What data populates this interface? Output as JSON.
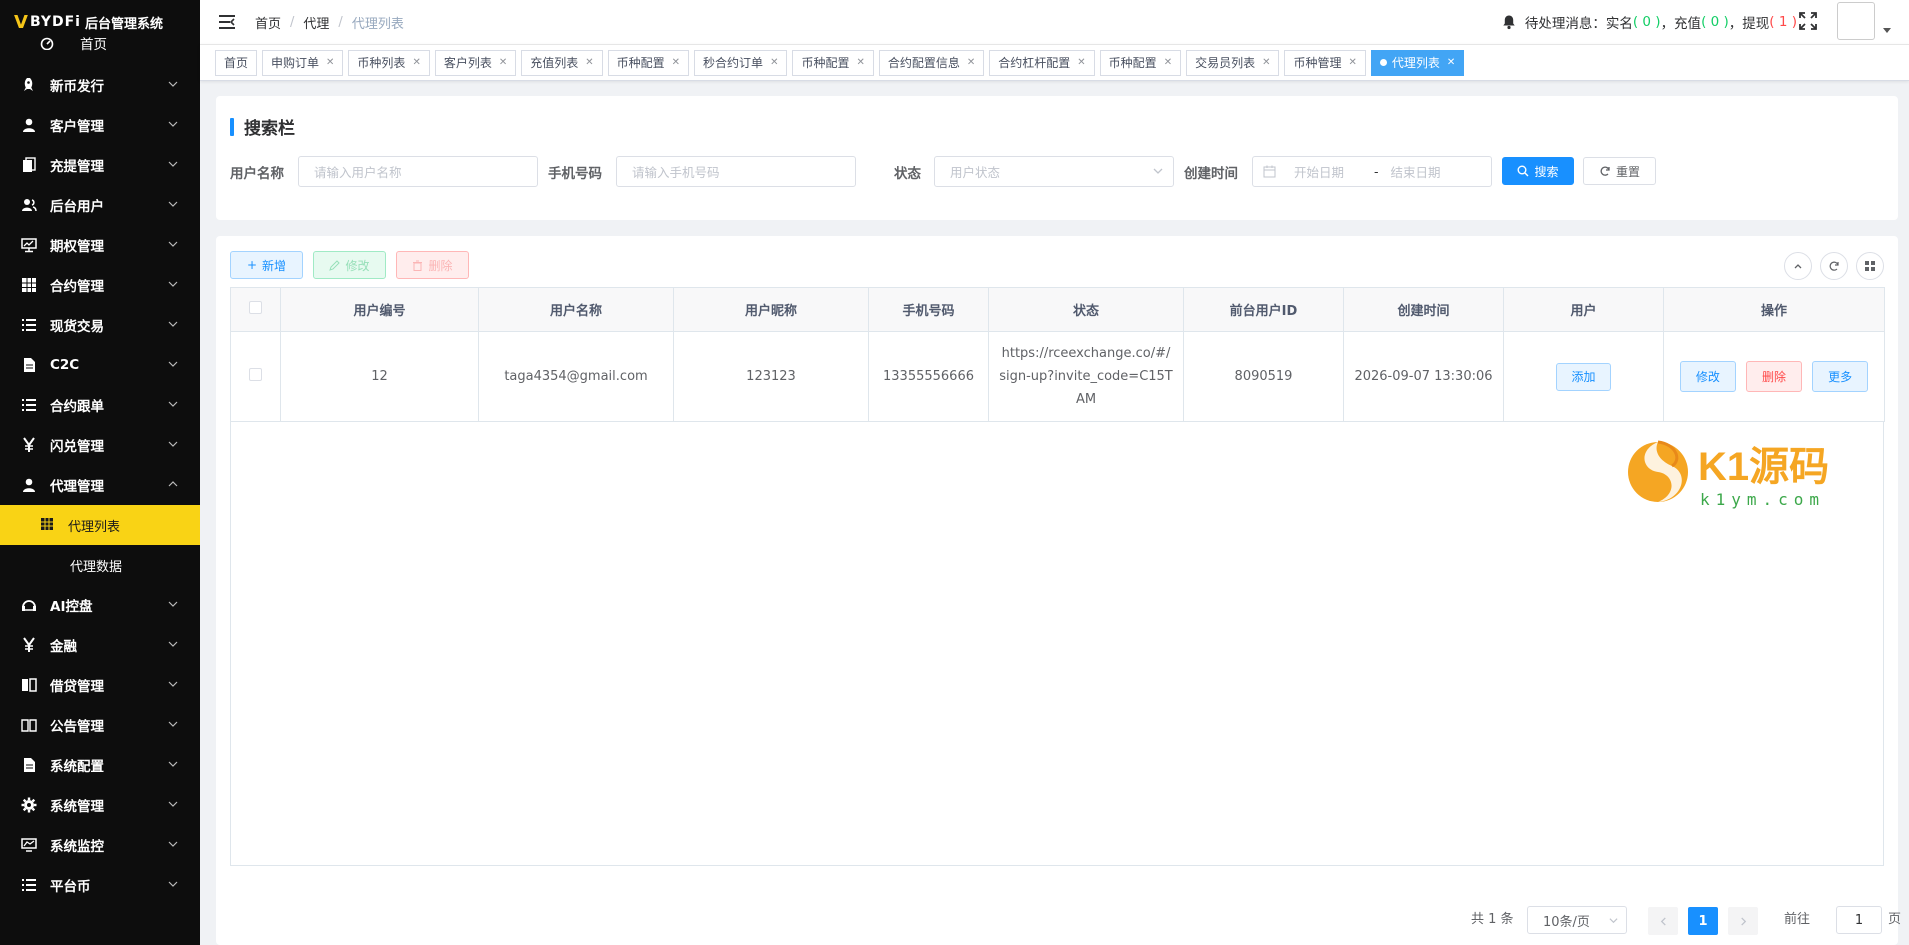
{
  "app": {
    "logo_mark": "V",
    "brand": "BYDFi",
    "title": "后台管理系统"
  },
  "sidebar": {
    "home": "首页",
    "items": [
      {
        "label": "新币发行",
        "icon": "rocket-icon"
      },
      {
        "label": "客户管理",
        "icon": "user-icon"
      },
      {
        "label": "充提管理",
        "icon": "documents-icon"
      },
      {
        "label": "后台用户",
        "icon": "users-icon"
      },
      {
        "label": "期权管理",
        "icon": "monitor-icon"
      },
      {
        "label": "合约管理",
        "icon": "grid-icon"
      },
      {
        "label": "现货交易",
        "icon": "list-icon"
      },
      {
        "label": "C2C",
        "icon": "document-icon"
      },
      {
        "label": "合约跟单",
        "icon": "list-icon"
      },
      {
        "label": "闪兑管理",
        "icon": "yen-icon"
      },
      {
        "label": "代理管理",
        "icon": "user-icon"
      }
    ],
    "sub_items": [
      {
        "label": "代理列表",
        "icon": "grid-icon"
      },
      {
        "label": "代理数据"
      }
    ],
    "items_after": [
      {
        "label": "AI控盘",
        "icon": "robot-icon"
      },
      {
        "label": "金融",
        "icon": "yen-icon"
      },
      {
        "label": "借贷管理",
        "icon": "book-icon"
      },
      {
        "label": "公告管理",
        "icon": "open-book-icon"
      },
      {
        "label": "系统配置",
        "icon": "document-icon"
      },
      {
        "label": "系统管理",
        "icon": "gear-icon"
      },
      {
        "label": "系统监控",
        "icon": "chart-monitor-icon"
      },
      {
        "label": "平台币",
        "icon": "list-icon"
      }
    ]
  },
  "header": {
    "breadcrumb": [
      "首页",
      "代理",
      "代理列表"
    ],
    "notice_prefix": "待处理消息：实名",
    "notice_realname_count": "( 0 )",
    "notice_recharge_label": "，充值",
    "notice_recharge_count": "( 0 )",
    "notice_withdraw_label": "，提现",
    "notice_withdraw_count": "( 1 )"
  },
  "tags": [
    {
      "label": "首页",
      "closable": false
    },
    {
      "label": "申购订单",
      "closable": true
    },
    {
      "label": "币种列表",
      "closable": true
    },
    {
      "label": "客户列表",
      "closable": true
    },
    {
      "label": "充值列表",
      "closable": true
    },
    {
      "label": "币种配置",
      "closable": true
    },
    {
      "label": "秒合约订单",
      "closable": true
    },
    {
      "label": "币种配置",
      "closable": true
    },
    {
      "label": "合约配置信息",
      "closable": true
    },
    {
      "label": "合约杠杆配置",
      "closable": true
    },
    {
      "label": "币种配置",
      "closable": true
    },
    {
      "label": "交易员列表",
      "closable": true
    },
    {
      "label": "币种管理",
      "closable": true
    },
    {
      "label": "代理列表",
      "closable": true,
      "active": true
    }
  ],
  "search": {
    "title": "搜索栏",
    "username_label": "用户名称",
    "username_placeholder": "请输入用户名称",
    "phone_label": "手机号码",
    "phone_placeholder": "请输入手机号码",
    "status_label": "状态",
    "status_placeholder": "用户状态",
    "created_label": "创建时间",
    "start_placeholder": "开始日期",
    "range_sep": "-",
    "end_placeholder": "结束日期",
    "search_button": "搜索",
    "reset_button": "重置"
  },
  "toolbar": {
    "add": "新增",
    "edit": "修改",
    "delete": "删除"
  },
  "table": {
    "columns": [
      "用户编号",
      "用户名称",
      "用户昵称",
      "手机号码",
      "状态",
      "前台用户ID",
      "创建时间",
      "用户",
      "操作"
    ],
    "rows": [
      {
        "id": "12",
        "username": "taga4354@gmail.com",
        "nickname": "123123",
        "phone": "13355556666",
        "status": "https://rceexchange.co/#/sign-up?invite_code=C15TAM",
        "front_user_id": "8090519",
        "created": "2026-09-07 13:30:06",
        "user_action": "添加",
        "op_edit": "修改",
        "op_delete": "删除",
        "op_more": "更多"
      }
    ]
  },
  "watermark": {
    "text_main": "K1源码",
    "text_sub": "k1ym.com"
  },
  "pagination": {
    "total": "共 1 条",
    "page_size": "10条/页",
    "current_page": "1",
    "goto_prefix": "前往",
    "goto_value": "1",
    "goto_suffix": "页"
  },
  "colors": {
    "accent": "#1890ff",
    "sidebar_bg": "#0d0d0d",
    "sidebar_active": "#f9d315",
    "danger": "#ff4949",
    "success": "#13ce66"
  }
}
